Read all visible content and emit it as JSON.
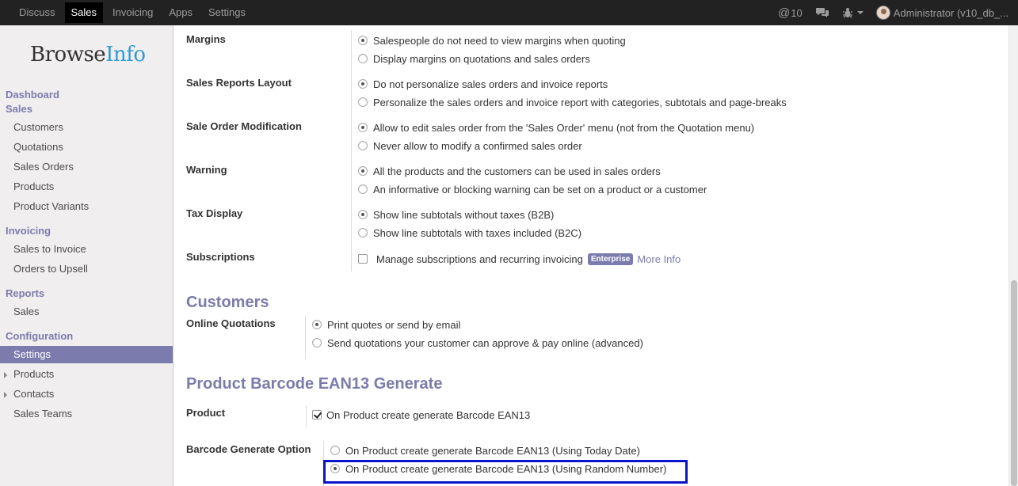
{
  "topbar": {
    "menu": [
      "Discuss",
      "Sales",
      "Invoicing",
      "Apps",
      "Settings"
    ],
    "active": "Sales",
    "mentions_count": "10",
    "user": "Administrator (v10_db_..."
  },
  "sidebar": {
    "logo_browse": "Browse",
    "logo_info": "Info",
    "dashboard": "Dashboard",
    "sales_header": "Sales",
    "sales_items": [
      "Customers",
      "Quotations",
      "Sales Orders",
      "Products",
      "Product Variants"
    ],
    "invoicing_header": "Invoicing",
    "invoicing_items": [
      "Sales to Invoice",
      "Orders to Upsell"
    ],
    "reports_header": "Reports",
    "reports_items": [
      "Sales"
    ],
    "configuration_header": "Configuration",
    "configuration_items": [
      "Settings",
      "Products",
      "Contacts",
      "Sales Teams"
    ]
  },
  "settings": {
    "margins": {
      "label": "Margins",
      "options": [
        "Salespeople do not need to view margins when quoting",
        "Display margins on quotations and sales orders"
      ]
    },
    "reports_layout": {
      "label": "Sales Reports Layout",
      "options": [
        "Do not personalize sales orders and invoice reports",
        "Personalize the sales orders and invoice report with categories, subtotals and page-breaks"
      ]
    },
    "order_modification": {
      "label": "Sale Order Modification",
      "options": [
        "Allow to edit sales order from the 'Sales Order' menu (not from the Quotation menu)",
        "Never allow to modify a confirmed sales order"
      ]
    },
    "warning": {
      "label": "Warning",
      "options": [
        "All the products and the customers can be used in sales orders",
        "An informative or blocking warning can be set on a product or a customer"
      ]
    },
    "tax_display": {
      "label": "Tax Display",
      "options": [
        "Show line subtotals without taxes (B2B)",
        "Show line subtotals with taxes included (B2C)"
      ]
    },
    "subscriptions": {
      "label": "Subscriptions",
      "option": "Manage subscriptions and recurring invoicing",
      "badge": "Enterprise",
      "link": "More Info"
    }
  },
  "customers": {
    "title": "Customers",
    "online_quotations": {
      "label": "Online Quotations",
      "options": [
        "Print quotes or send by email",
        "Send quotations your customer can approve & pay online (advanced)"
      ]
    }
  },
  "barcode": {
    "title": "Product Barcode EAN13 Generate",
    "product": {
      "label": "Product",
      "option": "On Product create generate Barcode EAN13"
    },
    "generate_option": {
      "label": "Barcode Generate Option",
      "options": [
        "On Product create generate Barcode EAN13 (Using Today Date)",
        "On Product create generate Barcode EAN13 (Using Random Number)"
      ]
    }
  },
  "colors": {
    "accent": "#7c7bad",
    "highlight_border": "#0a14c8"
  }
}
